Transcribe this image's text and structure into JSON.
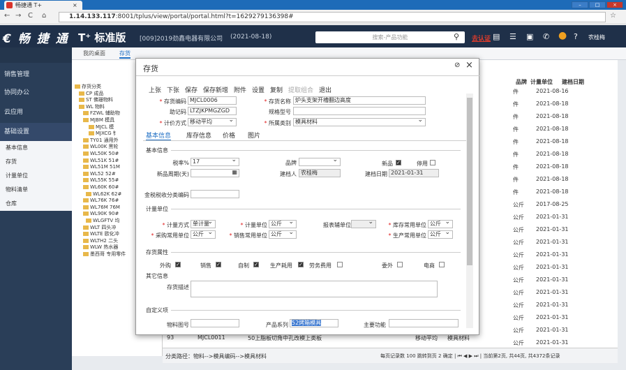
{
  "browser": {
    "tab_title": "畅捷通 T+",
    "url_host": "1.14.133.117",
    "url_rest": ":8001/tplus/view/portal/portal.html?t=1629279136398#"
  },
  "app": {
    "logo": "€ 畅 捷 通",
    "brand": "T⁺ 标准版",
    "company": "[009]2019劲鑫电器有限公司",
    "date": "(2021-08-18)",
    "search_placeholder": "搜索-产品功能",
    "auth": "去认证",
    "user": "农桂梅"
  },
  "sidebar": {
    "items": [
      "销售管理",
      "协同办公",
      "云应用",
      "基础设置"
    ],
    "subitems": [
      "基本信息",
      "存货",
      "计量单位",
      "物料清单",
      "仓库"
    ]
  },
  "page_tabs": [
    "我的桌面",
    "存货"
  ],
  "tree": [
    "存货分类",
    "CP 成品",
    "ST 佛珊物料",
    "WL 物料",
    "FZWL 辅助物",
    "MJBM 模具",
    "MJCL 模",
    "MJXCG 钅",
    "TY01 通用外",
    "WL00K 黑轮",
    "WL50K 50#",
    "WL51K 51#",
    "WL51M 51M",
    "WL52 52#",
    "WL55K 55#",
    "WL60K 60#",
    "WL62K 62#",
    "WL76K 76#",
    "WL76M 76M",
    "WL90K 90#",
    "WLGFTV 均",
    "WLT 四头冲",
    "WLTE 欧化冲",
    "WLTH2 二头",
    "WLW 热水器",
    "墨西哥 专用零件"
  ],
  "grid": {
    "headers": [
      "品牌",
      "计量单位",
      "建档日期"
    ],
    "units": [
      "件",
      "件",
      "件",
      "件",
      "件",
      "件",
      "件",
      "件",
      "件",
      "公斤",
      "公斤",
      "公斤",
      "公斤",
      "公斤",
      "公斤",
      "公斤",
      "公斤",
      "公斤",
      "公斤",
      "公斤",
      "公斤"
    ],
    "dates": [
      "2021-08-16",
      "2021-08-18",
      "2021-08-18",
      "2021-08-18",
      "2021-08-18",
      "2021-08-18",
      "2021-08-18",
      "2021-08-18",
      "2021-08-18",
      "2017-08-25",
      "2021-01-31",
      "2021-01-31",
      "2021-01-31",
      "2021-01-31",
      "2021-01-31",
      "2021-01-31",
      "2021-01-31",
      "2021-01-31",
      "2021-01-31",
      "2021-01-31",
      "2021-01-31"
    ],
    "row93": [
      "93",
      "MJCL0011",
      "50上脂板切角中孔改模上类板",
      "移动平均",
      "模具材料"
    ],
    "footer_path": "分类路径：物料-->模具编码-->模具材料",
    "footer_pager": "每页记录数 100  跳转到页 2  确定 | ⏮ ◀ ▶ ⏭ | 当前第2页, 共44页, 共4372条记录"
  },
  "dialog": {
    "title": "存货",
    "toolbar": [
      "上张",
      "下张",
      "保存",
      "保存新增",
      "附件",
      "设置",
      "复制",
      "提取组合",
      "退出"
    ],
    "fields": {
      "code_label": "存货编码",
      "code": "MJCL0006",
      "name_label": "存货名称",
      "name": "炉头支架开槽翻边高度",
      "mnemonic_label": "助记码",
      "mnemonic": "LTZJKPMGZGD",
      "spec_label": "规格型号",
      "spec": "",
      "costing_label": "计价方式",
      "costing": "移动平均",
      "category_label": "所属类别",
      "category": "模具材料"
    },
    "tabs": [
      "基本信息",
      "库存信息",
      "价格",
      "图片"
    ],
    "sections": {
      "basic": "基本信息",
      "unit": "计量单位",
      "attr": "存货属性",
      "other": "其它信息",
      "custom": "自定义项"
    },
    "basic": {
      "tax_label": "税率%",
      "tax": "17",
      "brand_label": "品牌",
      "new_label": "新品",
      "stop_label": "停用",
      "newperiod_label": "新品周期(天)",
      "creator_label": "建档人",
      "creator": "农桂梅",
      "date_label": "建档日期",
      "date": "2021-01-31",
      "taxcode_label": "金税税收分类编码"
    },
    "unit": {
      "mode_label": "计量方式",
      "mode": "单计量",
      "unit_label": "计量单位",
      "unit": "公斤",
      "report_label": "报表辅单位",
      "stock_label": "库存常用单位",
      "stock": "公斤",
      "purchase_label": "采购常用单位",
      "purchase": "公斤",
      "sale_label": "销售常用单位",
      "sale": "公斤",
      "prod_label": "生产常用单位",
      "prod": "公斤"
    },
    "attr": {
      "items": [
        "外购",
        "销售",
        "自制",
        "生产耗用",
        "劳务费用",
        "委外",
        "电商"
      ],
      "checked": [
        true,
        true,
        true,
        true,
        false,
        false,
        false
      ]
    },
    "other": {
      "desc_label": "存货描述"
    },
    "custom": {
      "drawing_label": "物料图号",
      "series_label": "产品系列",
      "series": "52烤箱模具",
      "func_label": "主要功能"
    }
  }
}
